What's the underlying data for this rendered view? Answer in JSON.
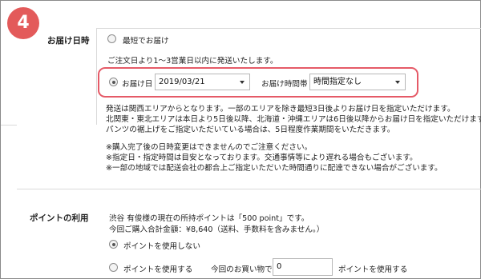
{
  "step": {
    "number": "4"
  },
  "delivery": {
    "section_label": "お届け日時",
    "option_earliest": "最短でお届け",
    "note_ship": "ご注文日より1〜3営業日以内に発送いたします。",
    "option_date_label": "お届け日",
    "date_value": "2019/03/21",
    "time_label": "お届け時間帯",
    "time_value": "時間指定なし",
    "info_lines": [
      "発送は関西エリアからとなります。一部のエリアを除き最短3日後よりお届け日を指定いただけます。",
      "北関東・東北エリアは本日より5日後以降、北海道・沖縄エリアは6日後以降からお届け日を指定いただけます",
      "パンツの裾上げをご指定いただいている場合は、5日程度作業期間をいただきます。"
    ],
    "notice_lines": [
      "※購入完了後の日時変更はできませんのでご注意ください。",
      "※指定日・指定時間は目安となっております。交通事情等により遅れる場合もございます。",
      "※一部の地域では配送会社の都合上ご指定いただいた時間通りに配達できない場合がございます。"
    ]
  },
  "points": {
    "section_label": "ポイントの利用",
    "balance_line": "渋谷 有俊様の現在の所持ポイントは「500 point」です。",
    "total_line": "今回ご購入合計金額：¥8,640（送料、手数料を含みません。）",
    "option_not_use": "ポイントを使用しない",
    "option_use": "ポイントを使用する",
    "use_prefix": "今回のお買い物で",
    "use_value": "0",
    "use_suffix": "ポイントを使用する"
  },
  "colors": {
    "accent": "#e35a5a",
    "highlight": "#e55a67"
  }
}
